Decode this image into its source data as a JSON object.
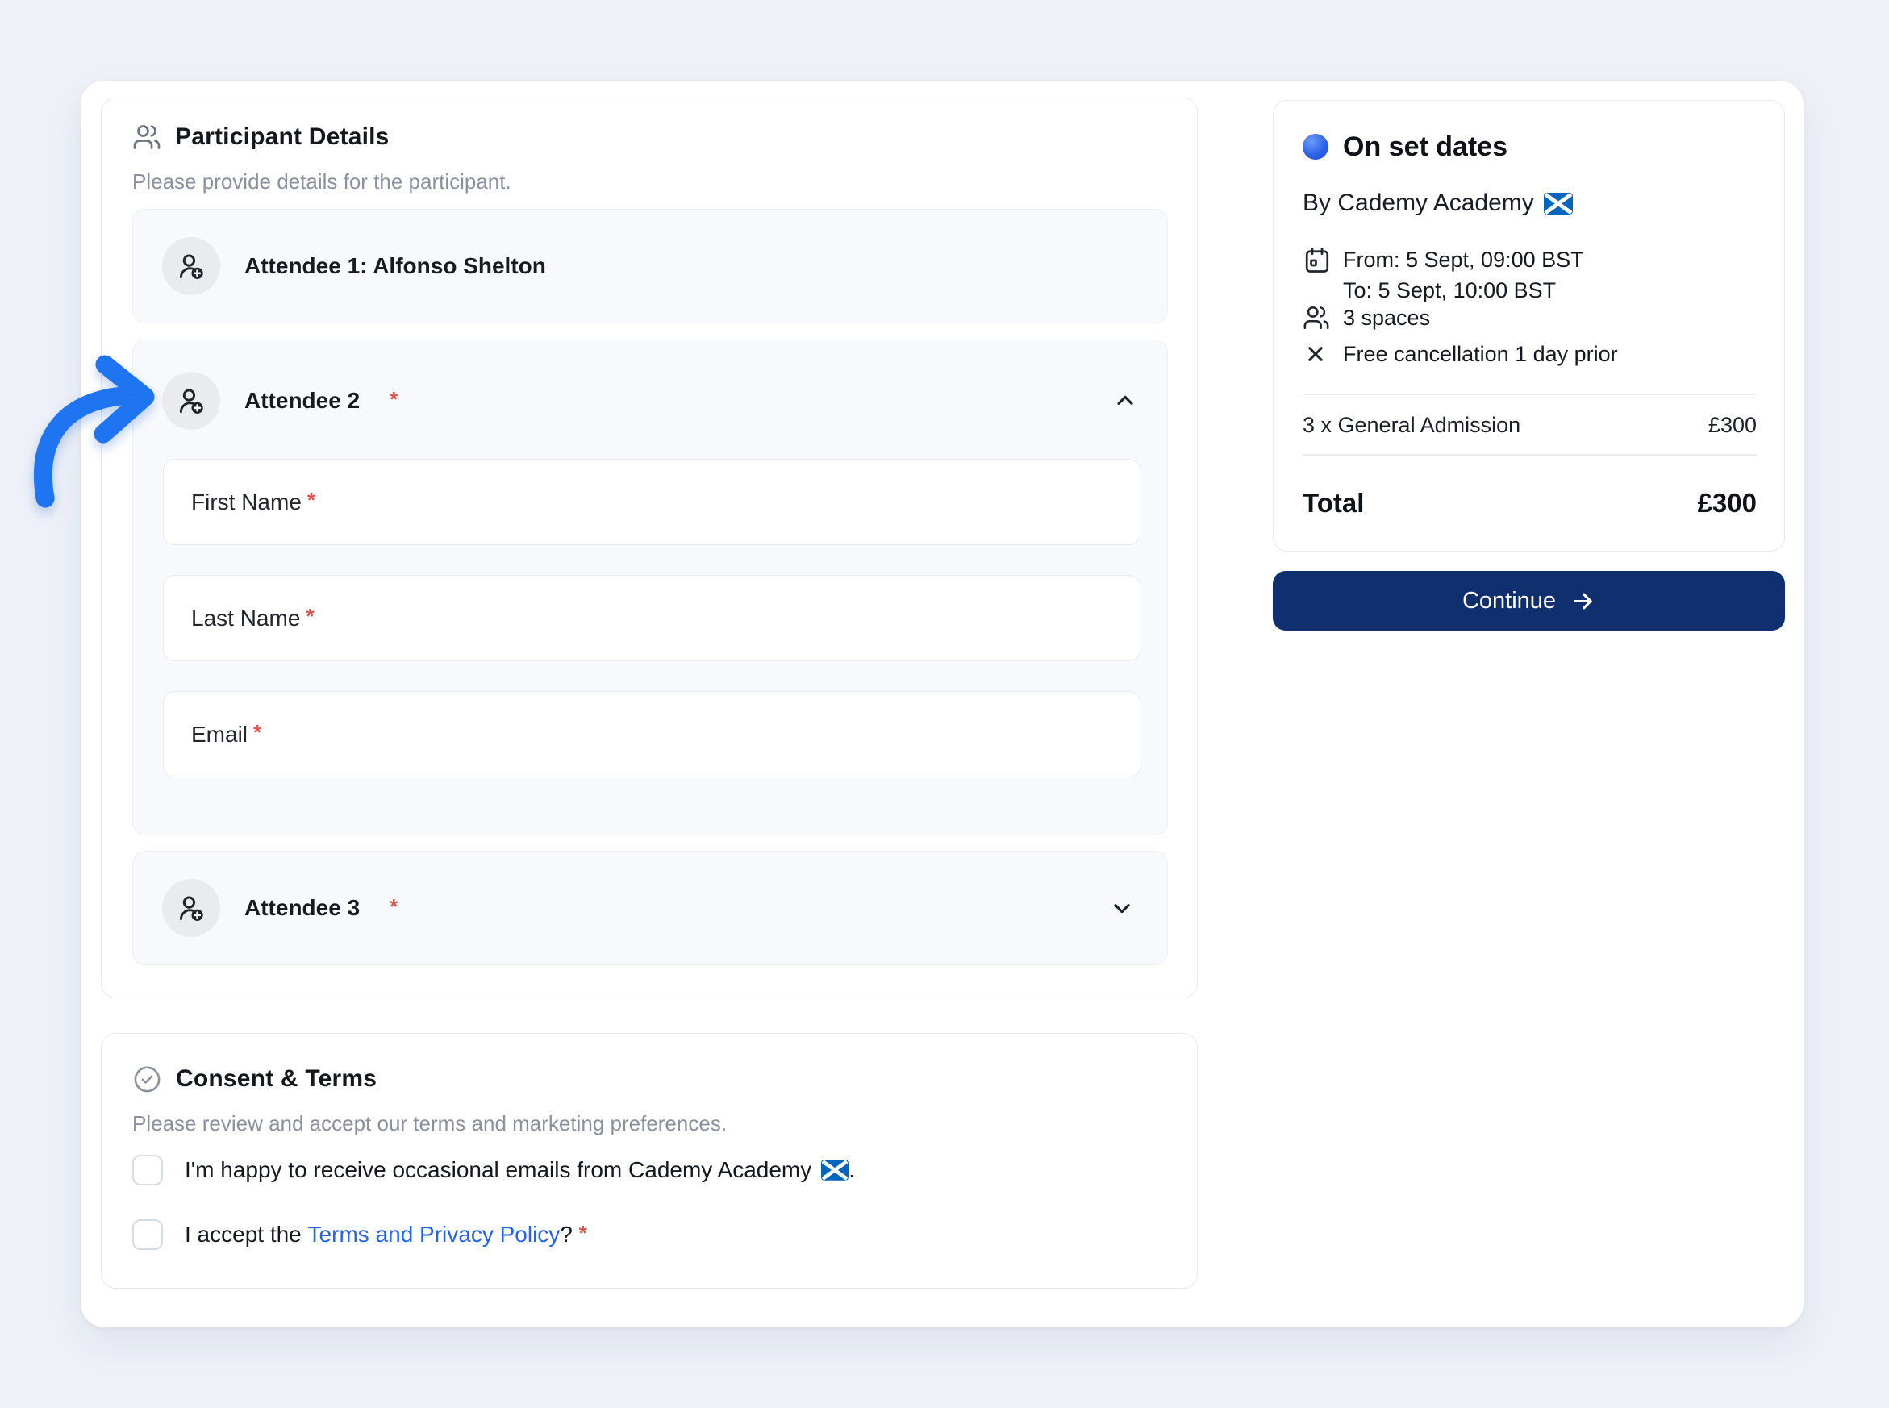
{
  "colors": {
    "annotation_blue": "#1E74F1",
    "button_navy": "#102F6E",
    "link_blue": "#2563EB",
    "required_red": "#E0524E",
    "flag_blue": "#0065BD"
  },
  "icons": {
    "participant_header": "users-icon",
    "attendee": "user-plus-icon",
    "consent_header": "circle-check-icon",
    "dates": "calendar-icon",
    "spaces": "users-icon",
    "cancellation": "x-icon",
    "expanded": "chevron-up-icon",
    "collapsed": "chevron-down-icon",
    "continue": "arrow-right-icon",
    "organizer_flag": "scotland-flag-icon",
    "event_bullet": "blue-circle-icon",
    "annotation": "curved-arrow-icon"
  },
  "participant": {
    "title": "Participant Details",
    "subtitle": "Please provide details for the participant.",
    "required_marker": "*",
    "attendee1": {
      "label": "Attendee 1: Alfonso Shelton"
    },
    "attendee2": {
      "label": "Attendee 2"
    },
    "attendee3": {
      "label": "Attendee 3"
    },
    "fields": {
      "first_name": {
        "label": "First Name",
        "value": ""
      },
      "last_name": {
        "label": "Last Name",
        "value": ""
      },
      "email": {
        "label": "Email",
        "value": ""
      }
    }
  },
  "summary": {
    "title": "On set dates",
    "by_line": "By Cademy Academy",
    "from_line": "From: 5 Sept, 09:00 BST",
    "to_line": "To: 5 Sept, 10:00 BST",
    "spaces": "3 spaces",
    "cancellation": "Free cancellation 1 day prior",
    "line_item": {
      "label": "3 x General Admission",
      "price": "£300"
    },
    "total_label": "Total",
    "total_price": "£300",
    "continue_label": "Continue"
  },
  "consent": {
    "title": "Consent & Terms",
    "subtitle": "Please review and accept our terms and marketing preferences.",
    "marketing_prefix": "I'm happy to receive occasional emails from Cademy Academy",
    "marketing_suffix": ".",
    "accept_prefix": "I accept the ",
    "accept_link": "Terms and Privacy Policy",
    "accept_suffix": "? ",
    "required_marker": "*",
    "marketing_checked": false,
    "terms_checked": false
  }
}
